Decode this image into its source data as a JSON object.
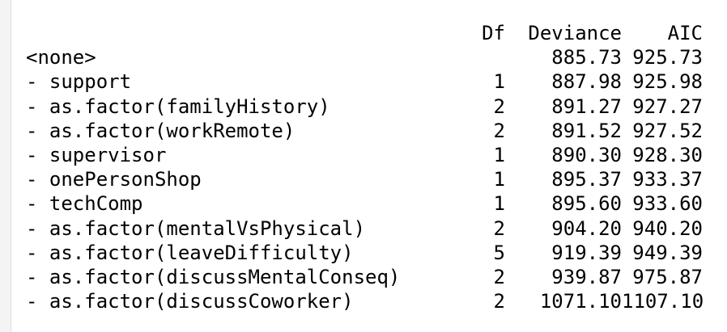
{
  "table": {
    "headers": {
      "term": "",
      "df": "Df",
      "deviance": "Deviance",
      "aic": "AIC"
    },
    "rows": [
      {
        "term": "<none>",
        "df": "",
        "deviance": "885.73",
        "aic": "925.73"
      },
      {
        "term": "- support",
        "df": "1",
        "deviance": "887.98",
        "aic": "925.98"
      },
      {
        "term": "- as.factor(familyHistory)",
        "df": "2",
        "deviance": "891.27",
        "aic": "927.27"
      },
      {
        "term": "- as.factor(workRemote)",
        "df": "2",
        "deviance": "891.52",
        "aic": "927.52"
      },
      {
        "term": "- supervisor",
        "df": "1",
        "deviance": "890.30",
        "aic": "928.30"
      },
      {
        "term": "- onePersonShop",
        "df": "1",
        "deviance": "895.37",
        "aic": "933.37"
      },
      {
        "term": "- techComp",
        "df": "1",
        "deviance": "895.60",
        "aic": "933.60"
      },
      {
        "term": "- as.factor(mentalVsPhysical)",
        "df": "2",
        "deviance": "904.20",
        "aic": "940.20"
      },
      {
        "term": "- as.factor(leaveDifficulty)",
        "df": "5",
        "deviance": "919.39",
        "aic": "949.39"
      },
      {
        "term": "- as.factor(discussMentalConseq)",
        "df": "2",
        "deviance": "939.87",
        "aic": "975.87"
      },
      {
        "term": "- as.factor(discussCoworker)",
        "df": "2",
        "deviance": "1071.10",
        "aic": "1107.10"
      }
    ]
  }
}
